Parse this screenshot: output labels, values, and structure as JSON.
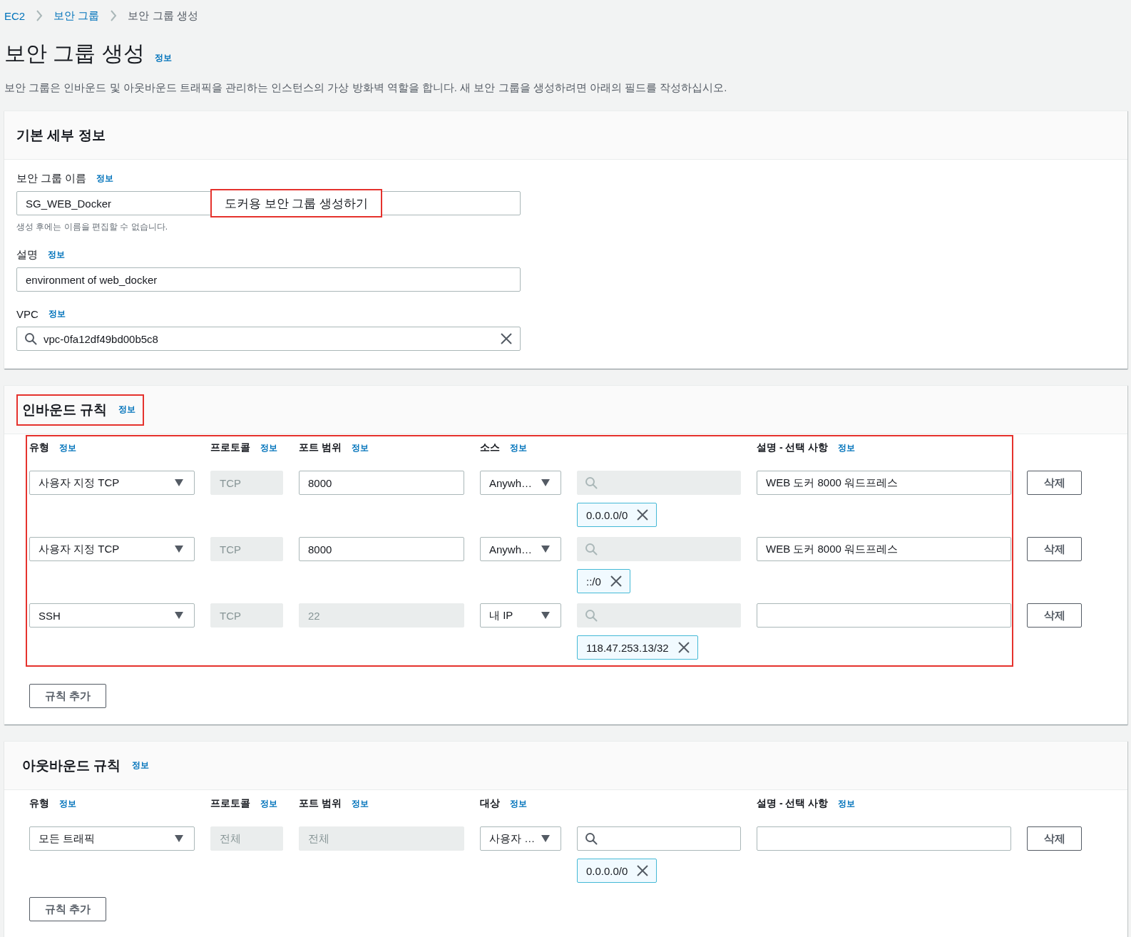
{
  "breadcrumb": [
    {
      "label": "EC2",
      "link": true
    },
    {
      "label": "보안 그룹",
      "link": true
    },
    {
      "label": "보안 그룹 생성",
      "link": false
    }
  ],
  "page": {
    "title": "보안 그룹 생성",
    "info": "정보",
    "description": "보안 그룹은 인바운드 및 아웃바운드 트래픽을 관리하는 인스턴스의 가상 방화벽 역할을 합니다. 새 보안 그룹을 생성하려면 아래의 필드를 작성하십시오."
  },
  "basic_details": {
    "title": "기본 세부 정보",
    "fields": [
      {
        "kind": "text",
        "label": "보안 그룹 이름",
        "info": "정보",
        "value": "SG_WEB_Docker",
        "hint": "생성 후에는 이름을 편집할 수 없습니다.",
        "note": "도커용 보안 그룹 생성하기"
      },
      {
        "kind": "text",
        "label": "설명",
        "info": "정보",
        "value": "environment of web_docker"
      },
      {
        "kind": "search",
        "label": "VPC",
        "info": "정보",
        "value": "vpc-0fa12df49bd00b5c8"
      }
    ]
  },
  "inbound": {
    "title": "인바운드 규칙",
    "info": "정보",
    "highlighted": true,
    "table_highlighted": true,
    "columns": [
      {
        "label": "유형",
        "info": "정보"
      },
      {
        "label": "프로토콜",
        "info": "정보"
      },
      {
        "label": "포트 범위",
        "info": "정보"
      },
      {
        "label": "소스",
        "info": "정보"
      },
      {
        "label": "설명 - 선택 사항",
        "info": "정보"
      }
    ],
    "rules": [
      {
        "type": "사용자 지정 TCP",
        "protocol": {
          "value": "TCP",
          "disabled": true
        },
        "port": {
          "value": "8000",
          "disabled": false
        },
        "source": "Anywh…",
        "search_disabled": true,
        "tokens": [
          "0.0.0.0/0"
        ],
        "description": "WEB 도커 8000 워드프레스",
        "delete": "삭제"
      },
      {
        "type": "사용자 지정 TCP",
        "protocol": {
          "value": "TCP",
          "disabled": true
        },
        "port": {
          "value": "8000",
          "disabled": false
        },
        "source": "Anywh…",
        "search_disabled": true,
        "tokens": [
          "::/0"
        ],
        "description": "WEB 도커 8000 워드프레스",
        "delete": "삭제"
      },
      {
        "type": "SSH",
        "protocol": {
          "value": "TCP",
          "disabled": true
        },
        "port": {
          "value": "22",
          "disabled": true
        },
        "source": "내 IP",
        "search_disabled": true,
        "tokens": [
          "118.47.253.13/32"
        ],
        "delete": "삭제"
      }
    ],
    "add_button": "규칙 추가"
  },
  "outbound": {
    "title": "아웃바운드 규칙",
    "info": "정보",
    "columns": [
      {
        "label": "유형",
        "info": "정보"
      },
      {
        "label": "프로토콜",
        "info": "정보"
      },
      {
        "label": "포트 범위",
        "info": "정보"
      },
      {
        "label": "대상",
        "info": "정보"
      },
      {
        "label": "설명 - 선택 사항",
        "info": "정보"
      }
    ],
    "rules": [
      {
        "type": "모든 트래픽",
        "protocol": {
          "value": "전체",
          "disabled": true
        },
        "port": {
          "value": "전체",
          "disabled": true
        },
        "source": "사용자 …",
        "search_disabled": false,
        "tokens": [
          "0.0.0.0/0"
        ],
        "delete": "삭제"
      }
    ],
    "add_button": "규칙 추가"
  }
}
